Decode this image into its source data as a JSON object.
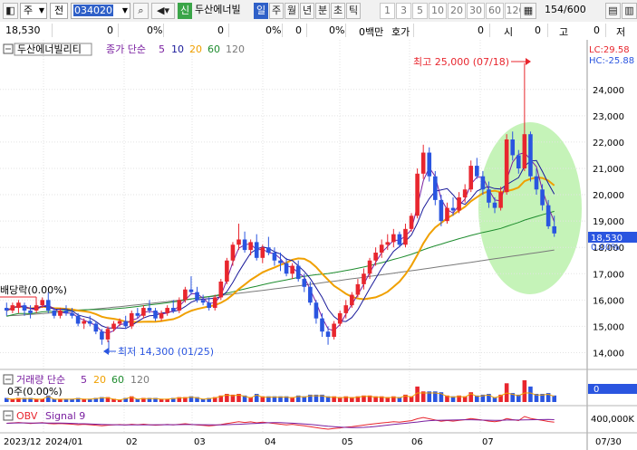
{
  "toolbar": {
    "market_label": "주",
    "prev_label": "전",
    "code_value": "034020",
    "stock_badge": "신",
    "stock_name": "두산에너빌",
    "periods": [
      "일",
      "주",
      "월",
      "년",
      "분",
      "초",
      "틱"
    ],
    "selected_period": "일",
    "intervals": [
      "1",
      "3",
      "5",
      "10",
      "20",
      "30",
      "60",
      "120"
    ],
    "count_value": "154",
    "count_total": "/600"
  },
  "info_bar": {
    "cells": [
      "18,530",
      "0",
      "0%",
      "0",
      "0%",
      "0",
      "0%",
      "0백만",
      "호가",
      "0",
      "시",
      "0",
      "고",
      "0",
      "저"
    ]
  },
  "price_panel": {
    "title_box": "두산에너빌리티",
    "ma_title": "종가 단순",
    "ma_periods": [
      "5",
      "10",
      "20",
      "60",
      "120"
    ],
    "lc_label": "LC:29.58",
    "hc_label": "HC:-25.88",
    "high_annotation": "최고 25,000 (07/18)",
    "low_annotation": "최저 14,300 (01/25)",
    "dividend_annotation": "배당락(0.00%)",
    "current_price": "18,530",
    "current_change": "0.00%"
  },
  "volume_panel": {
    "title": "거래량 단순",
    "ma_periods": [
      "5",
      "20",
      "60",
      "120"
    ],
    "sub_label": "0주(0.00%)",
    "axis_label": "0"
  },
  "obv_panel": {
    "title": "OBV",
    "signal_label": "Signal 9",
    "axis_label": "400,000K"
  },
  "x_axis": {
    "labels": [
      "2023/12",
      "2024/01",
      "02",
      "03",
      "04",
      "05",
      "06",
      "07",
      "07/30"
    ]
  },
  "colors": {
    "up": "#e8262e",
    "down": "#2a55e0",
    "ma5": "#7a1fa0",
    "ma10": "#1a1a9a",
    "ma20": "#f0a000",
    "ma60": "#1e8c2e",
    "ma120": "#7a7a7a",
    "highlight": "#bff2b0"
  },
  "chart_data": {
    "type": "candlestick",
    "y_axis": {
      "ylim": [
        13500,
        25300
      ],
      "ticks": [
        14000,
        15000,
        16000,
        17000,
        18000,
        19000,
        20000,
        21000,
        22000,
        23000,
        24000
      ]
    },
    "ohlc": [
      [
        15700,
        15900,
        15400,
        15600
      ],
      [
        15600,
        15900,
        15500,
        15800
      ],
      [
        15700,
        16000,
        15500,
        15900
      ],
      [
        15800,
        15900,
        15400,
        15600
      ],
      [
        15600,
        15800,
        15300,
        15500
      ],
      [
        15600,
        15900,
        15500,
        15800
      ],
      [
        15800,
        16100,
        15700,
        16000
      ],
      [
        16000,
        16300,
        15500,
        15600
      ],
      [
        15600,
        15700,
        15300,
        15400
      ],
      [
        15400,
        15700,
        15300,
        15600
      ],
      [
        15600,
        15800,
        15400,
        15500
      ],
      [
        15500,
        15700,
        15300,
        15400
      ],
      [
        15400,
        15500,
        15000,
        15100
      ],
      [
        15100,
        15300,
        14900,
        15200
      ],
      [
        15200,
        15400,
        15000,
        15100
      ],
      [
        15100,
        15200,
        14700,
        14800
      ],
      [
        14800,
        14900,
        14300,
        14500
      ],
      [
        14500,
        15000,
        14400,
        14900
      ],
      [
        14900,
        15200,
        14800,
        15100
      ],
      [
        15100,
        15300,
        15000,
        15200
      ],
      [
        15200,
        15400,
        14900,
        15000
      ],
      [
        15000,
        15600,
        14900,
        15500
      ],
      [
        15500,
        15700,
        15300,
        15400
      ],
      [
        15400,
        15800,
        15300,
        15700
      ],
      [
        15700,
        16000,
        15500,
        15600
      ],
      [
        15600,
        15700,
        15200,
        15300
      ],
      [
        15300,
        15600,
        15200,
        15500
      ],
      [
        15500,
        15800,
        15400,
        15700
      ],
      [
        15700,
        16000,
        15500,
        15600
      ],
      [
        15600,
        16100,
        15500,
        16000
      ],
      [
        16000,
        16500,
        15900,
        16400
      ],
      [
        16400,
        16900,
        16200,
        16300
      ],
      [
        16300,
        16500,
        15900,
        16000
      ],
      [
        16000,
        16200,
        15800,
        15900
      ],
      [
        15900,
        16100,
        15600,
        15700
      ],
      [
        15700,
        16200,
        15600,
        16100
      ],
      [
        16100,
        16800,
        16000,
        16700
      ],
      [
        16700,
        17600,
        16600,
        17500
      ],
      [
        17500,
        18200,
        17300,
        18100
      ],
      [
        18100,
        18900,
        17900,
        18300
      ],
      [
        18300,
        18600,
        17800,
        17900
      ],
      [
        17900,
        18300,
        17700,
        18200
      ],
      [
        18200,
        18500,
        17500,
        17600
      ],
      [
        17600,
        18100,
        17400,
        18000
      ],
      [
        18000,
        18400,
        17700,
        17800
      ],
      [
        17800,
        18000,
        17300,
        17500
      ],
      [
        17500,
        17800,
        17100,
        17400
      ],
      [
        17400,
        17600,
        16900,
        17000
      ],
      [
        17000,
        17400,
        16800,
        17300
      ],
      [
        17300,
        17500,
        16700,
        16800
      ],
      [
        16800,
        17000,
        16300,
        16500
      ],
      [
        16500,
        16700,
        15800,
        15900
      ],
      [
        15900,
        16000,
        15100,
        15300
      ],
      [
        15300,
        15500,
        14600,
        14800
      ],
      [
        14800,
        15000,
        14300,
        14600
      ],
      [
        14600,
        15200,
        14500,
        15100
      ],
      [
        15100,
        15600,
        15000,
        15500
      ],
      [
        15500,
        16000,
        15300,
        15800
      ],
      [
        15800,
        16300,
        15700,
        16200
      ],
      [
        16200,
        16800,
        16100,
        16600
      ],
      [
        16600,
        17200,
        16400,
        17000
      ],
      [
        17000,
        17600,
        16800,
        17500
      ],
      [
        17500,
        18000,
        17300,
        17800
      ],
      [
        17800,
        18300,
        17600,
        18100
      ],
      [
        18100,
        18500,
        17900,
        18200
      ],
      [
        18200,
        18700,
        18000,
        18500
      ],
      [
        18500,
        18600,
        18000,
        18100
      ],
      [
        18100,
        18900,
        18000,
        18700
      ],
      [
        18700,
        19300,
        18600,
        19200
      ],
      [
        19200,
        21000,
        19100,
        20800
      ],
      [
        20800,
        21900,
        20600,
        21600
      ],
      [
        21600,
        21800,
        20500,
        20700
      ],
      [
        20700,
        20900,
        19600,
        19800
      ],
      [
        19800,
        20000,
        18800,
        19000
      ],
      [
        19000,
        19700,
        18900,
        19500
      ],
      [
        19500,
        19900,
        19200,
        19400
      ],
      [
        19400,
        20100,
        19300,
        19900
      ],
      [
        19900,
        20400,
        19700,
        20200
      ],
      [
        20200,
        21300,
        20100,
        21100
      ],
      [
        21100,
        21400,
        20600,
        20700
      ],
      [
        20700,
        20900,
        20000,
        20200
      ],
      [
        20200,
        20500,
        19500,
        19700
      ],
      [
        19700,
        19900,
        19300,
        19500
      ],
      [
        19500,
        20300,
        19400,
        20100
      ],
      [
        20100,
        22300,
        20000,
        22100
      ],
      [
        22100,
        22400,
        21300,
        21500
      ],
      [
        21500,
        21700,
        20800,
        21000
      ],
      [
        21000,
        25000,
        20900,
        22300
      ],
      [
        22300,
        22400,
        20500,
        20700
      ],
      [
        20700,
        21000,
        20000,
        20200
      ],
      [
        20200,
        20400,
        19400,
        19600
      ],
      [
        19600,
        19800,
        18700,
        18800
      ],
      [
        18800,
        19200,
        18400,
        18530
      ]
    ],
    "ma5_end": 18900,
    "ma20_end": 20300,
    "ma60_end": 19700,
    "ma120_end": 17900
  }
}
